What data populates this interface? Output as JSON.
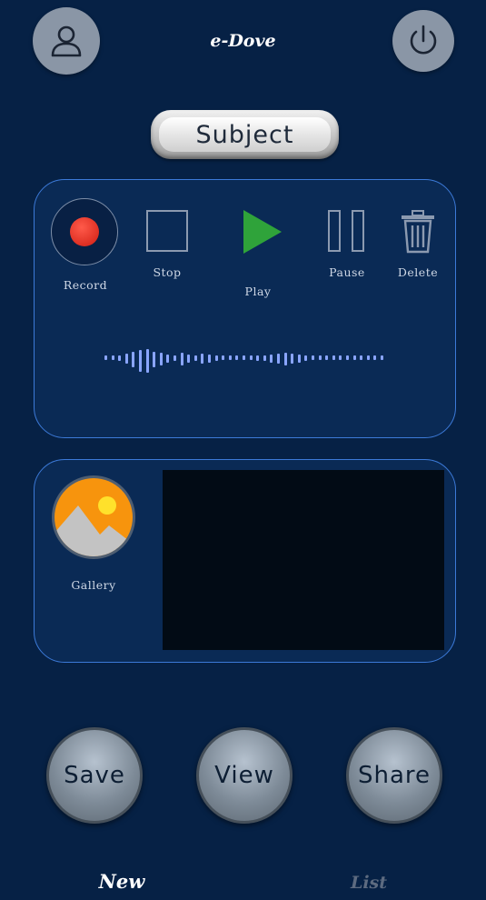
{
  "header": {
    "title": "e-Dove",
    "profile_icon": "user-icon",
    "power_icon": "power-icon"
  },
  "subject": {
    "label": "Subject"
  },
  "recorder": {
    "record_label": "Record",
    "stop_label": "Stop",
    "play_label": "Play",
    "pause_label": "Pause",
    "delete_label": "Delete",
    "colors": {
      "record": "#e02518",
      "play": "#2fa33a",
      "wave": "#8aa5ff"
    },
    "waveform_levels": [
      2,
      2,
      3,
      5,
      8,
      11,
      12,
      8,
      6,
      4,
      3,
      6,
      4,
      3,
      5,
      4,
      3,
      2,
      2,
      2,
      2,
      2,
      3,
      3,
      4,
      5,
      6,
      5,
      4,
      3,
      2,
      2,
      2,
      2,
      2,
      2,
      2,
      2,
      2,
      2,
      2
    ]
  },
  "media": {
    "gallery_label": "Gallery",
    "gallery_icon": "image-icon"
  },
  "actions": {
    "save_label": "Save",
    "view_label": "View",
    "share_label": "Share"
  },
  "nav": {
    "tabs": [
      {
        "label": "New",
        "active": true
      },
      {
        "label": "List",
        "active": false
      }
    ]
  },
  "colors": {
    "background": "#062145",
    "panel_border": "#3c7ad8"
  }
}
